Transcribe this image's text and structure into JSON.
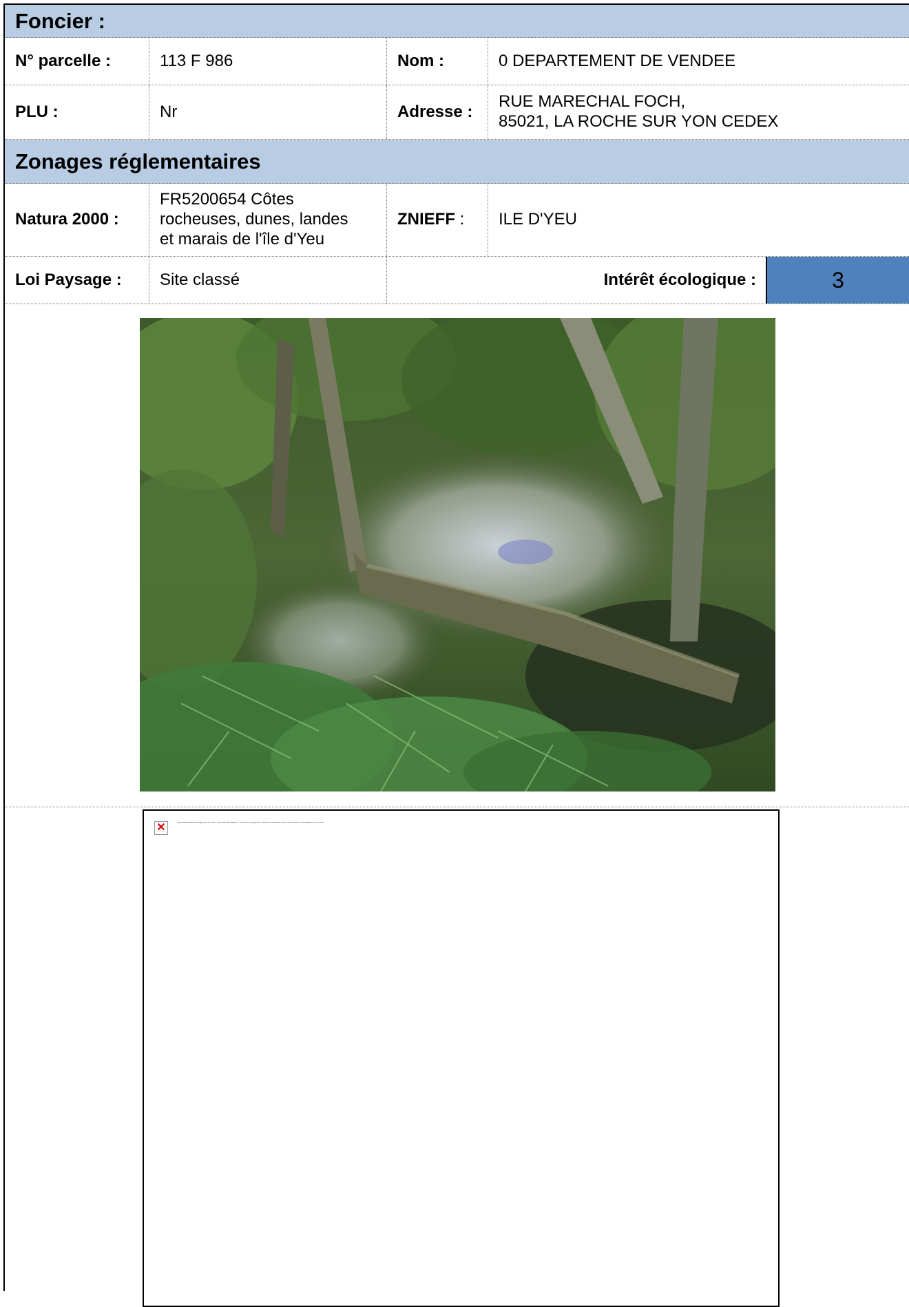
{
  "sections": {
    "foncier": "Foncier :",
    "zonages": "Zonages réglementaires"
  },
  "foncier": {
    "parcelle_label": "N° parcelle :",
    "parcelle_value": "113 F 986",
    "nom_label": "Nom :",
    "nom_value": "0 DEPARTEMENT DE VENDEE",
    "plu_label": "PLU :",
    "plu_value": "Nr",
    "adresse_label": "Adresse :",
    "adresse_line1": "RUE MARECHAL FOCH,",
    "adresse_line2": "85021, LA ROCHE SUR YON CEDEX"
  },
  "zonages": {
    "natura_label": "Natura 2000 :",
    "natura_line1": "FR5200654 Côtes",
    "natura_line2": "rocheuses, dunes, landes",
    "natura_line3": "et marais de l'île d'Yeu",
    "znieff_label": "ZNIEFF",
    "znieff_colon": " :",
    "znieff_value": "ILE D'YEU",
    "loi_label": "Loi Paysage :",
    "loi_value": "Site classé",
    "interet_label": "Intérêt écologique :",
    "interet_value": "3"
  },
  "photo": {
    "subject": "forest-undergrowth-with-ferns-and-fallen-trunk"
  },
  "broken_image": {
    "icon": "broken-image-icon",
    "message": "Impossible d'afficher l'image liée. Le fichier a peut-être été déplacé, renommé ou supprimé. Vérifiez que la liaison pointe vers le fichier et l'emplacement corrects."
  },
  "colors": {
    "header_band": "#b8cce4",
    "score_box": "#4f81bd"
  }
}
